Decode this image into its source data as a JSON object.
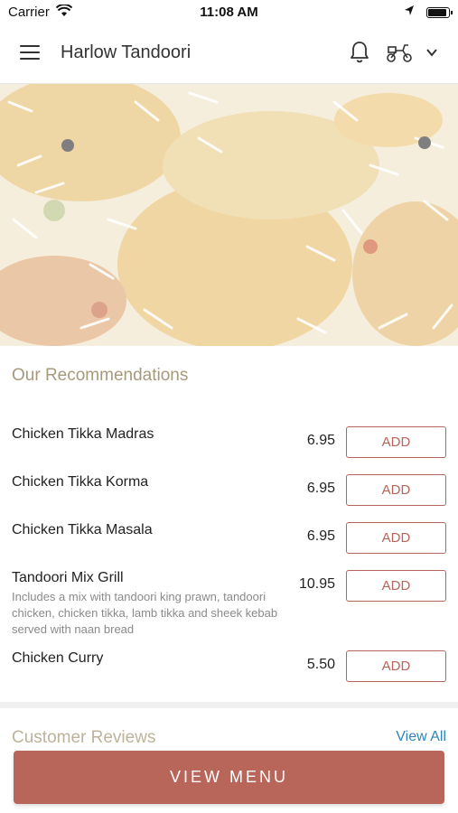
{
  "status_bar": {
    "carrier": "Carrier",
    "time": "11:08 AM"
  },
  "header": {
    "title": "Harlow Tandoori"
  },
  "recommendations": {
    "title": "Our Recommendations",
    "items": [
      {
        "name": "Chicken Tikka Madras",
        "description": "",
        "price": "6.95",
        "button": "ADD"
      },
      {
        "name": "Chicken Tikka Korma",
        "description": "",
        "price": "6.95",
        "button": "ADD"
      },
      {
        "name": "Chicken Tikka Masala",
        "description": "",
        "price": "6.95",
        "button": "ADD"
      },
      {
        "name": "Tandoori Mix Grill",
        "description": "Includes a mix with tandoori king prawn, tandoori chicken, chicken tikka, lamb tikka and sheek kebab served with naan bread",
        "price": "10.95",
        "button": "ADD"
      },
      {
        "name": "Chicken Curry",
        "description": "",
        "price": "5.50",
        "button": "ADD"
      }
    ]
  },
  "reviews": {
    "title": "Customer Reviews",
    "view_all": "View All"
  },
  "footer": {
    "view_menu_label": "VIEW MENU"
  },
  "colors": {
    "accent": "#b9665a",
    "link": "#2f86b6",
    "section_title": "#a59a7c"
  }
}
